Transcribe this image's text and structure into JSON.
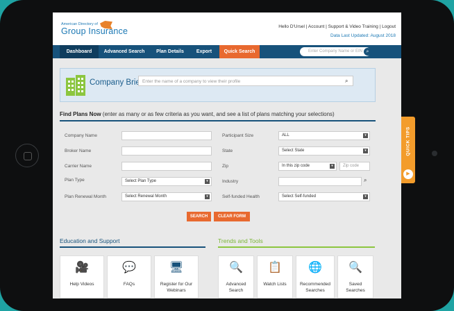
{
  "header": {
    "logo_small": "American Directory of",
    "logo_big": "Group Insurance",
    "top_links": "Hello D'Ursel | Account | Support & Video Training | Logout",
    "last_updated": "Data Last Updated: August 2018"
  },
  "nav": {
    "items": [
      "Dashboard",
      "Advanced Search",
      "Plan Details",
      "Export",
      "Quick Search"
    ],
    "search_placeholder": "Enter Company Name or EIN"
  },
  "brief": {
    "title": "Company Brief",
    "placeholder": "Enter the name of a company to view their profile"
  },
  "find": {
    "title_bold": "Find Plans Now",
    "title_rest": " (enter as many or as few criteria as you want, and see a list of plans matching your selections)"
  },
  "form": {
    "left_labels": [
      "Company Name",
      "Broker Name",
      "Carrier Name",
      "Plan Type",
      "Plan Renewal Month"
    ],
    "plan_type_value": "Select Plan Type",
    "renewal_value": "Select Renewal Month",
    "right_labels": [
      "Participant Size",
      "State",
      "Zip",
      "Industry",
      "Self-funded Health"
    ],
    "participant_value": "ALL",
    "state_value": "Select State",
    "zip_select_value": "In this zip code",
    "zip_placeholder": "Zip code",
    "self_funded_value": "Select Self-funded"
  },
  "buttons": {
    "search": "SEARCH",
    "clear": "CLEAR FORM"
  },
  "education": {
    "title": "Education and Support",
    "cards": [
      "Help Videos",
      "FAQs",
      "Register for Our Webinars"
    ]
  },
  "trends": {
    "title": "Trends and Tools",
    "cards": [
      "Advanced Search",
      "Watch Lists",
      "Recommended Searches",
      "Saved Searches"
    ]
  },
  "quick_tips": "QUICK TIPS",
  "colors": {
    "nav": "#17527b",
    "accent": "#e8692f",
    "trends": "#8cc63f",
    "background": "#1fa3a3"
  }
}
